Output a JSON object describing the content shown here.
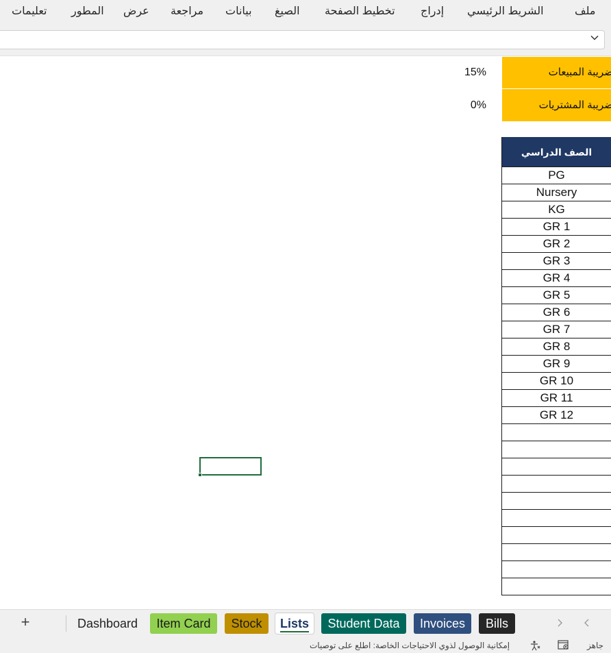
{
  "ribbon": {
    "tabs": [
      {
        "label": "ملف"
      },
      {
        "label": "الشريط الرئيسي"
      },
      {
        "label": "إدراج"
      },
      {
        "label": "تخطيط الصفحة"
      },
      {
        "label": "الصيغ"
      },
      {
        "label": "بيانات"
      },
      {
        "label": "مراجعة"
      },
      {
        "label": "عرض"
      },
      {
        "label": "المطور"
      },
      {
        "label": "تعليمات"
      }
    ]
  },
  "sheet": {
    "sales_tax": {
      "label": "ضريبة المبيعات",
      "value": "15%"
    },
    "purchase_tax": {
      "label": "ضريبة المشتريات",
      "value": "0%"
    },
    "grade_column": {
      "header": "الصف الدراسي",
      "values": [
        "PG",
        "Nursery",
        "KG",
        "GR 1",
        "GR 2",
        "GR 3",
        "GR 4",
        "GR 5",
        "GR 6",
        "GR 7",
        "GR 8",
        "GR 9",
        "GR 10",
        "GR 11",
        "GR 12",
        "",
        "",
        "",
        "",
        "",
        "",
        "",
        "",
        "",
        ""
      ]
    }
  },
  "sheet_tabs": {
    "add_label": "+",
    "tabs": [
      {
        "label": "Dashboard",
        "color": "#f0f0f0",
        "text_color": "#222222"
      },
      {
        "label": "Item Card",
        "color": "#92d050",
        "text_color": "#1a1a1a"
      },
      {
        "label": "Stock",
        "color": "#bf8f00",
        "text_color": "#1a1a1a"
      },
      {
        "label": "Lists",
        "color": "#ffffff",
        "text_color": "#1f3864",
        "active": true
      },
      {
        "label": "Student Data",
        "color": "#00695c",
        "text_color": "#ffffff"
      },
      {
        "label": "Invoices",
        "color": "#2f4f7f",
        "text_color": "#ffffff"
      },
      {
        "label": "Bills",
        "color": "#262626",
        "text_color": "#ffffff"
      }
    ]
  },
  "status": {
    "ready": "جاهز",
    "accessibility": "إمكانية الوصول لذوي الاحتياجات الخاصة: اطلع على توصيات"
  },
  "colors": {
    "tax_fill": "#ffc000",
    "header_fill": "#1f3864",
    "selection": "#1e6b3c"
  }
}
